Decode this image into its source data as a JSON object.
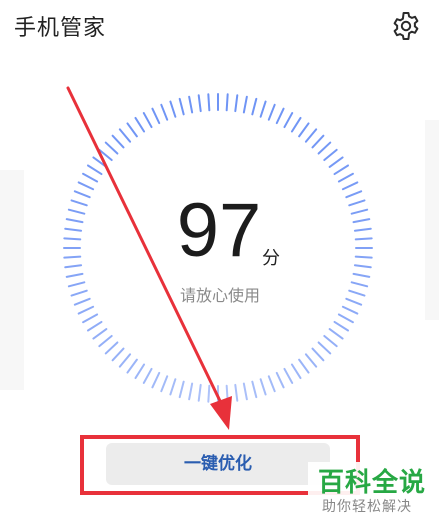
{
  "header": {
    "title": "手机管家",
    "settings_icon": "gear-icon"
  },
  "score": {
    "value": "97",
    "unit": "分",
    "status": "请放心使用"
  },
  "actions": {
    "optimize_label": "一键优化"
  },
  "annotation": {
    "color": "#e8313a"
  },
  "colors": {
    "dial_tick": "#6f94f5",
    "button_text": "#2a5db0",
    "watermark_green": "#27a844"
  },
  "watermark": {
    "title": "百科全说",
    "subtitle": "助你轻松解决"
  }
}
